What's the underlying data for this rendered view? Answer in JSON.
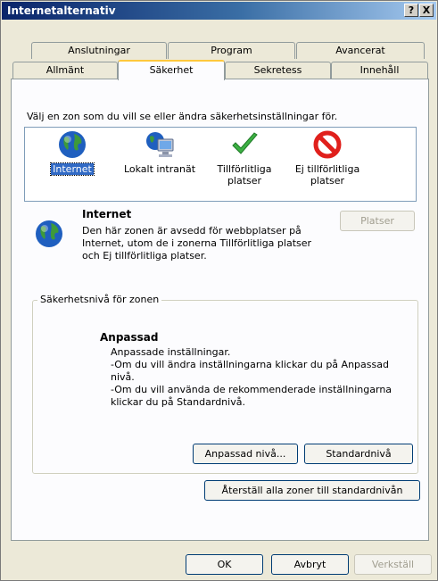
{
  "window": {
    "title": "Internetalternativ",
    "help_button": "?",
    "close_button": "X"
  },
  "tabs": {
    "row1": [
      "Anslutningar",
      "Program",
      "Avancerat"
    ],
    "row2": [
      "Allmänt",
      "Säkerhet",
      "Sekretess",
      "Innehåll"
    ],
    "active": "Säkerhet"
  },
  "zones": {
    "prompt": "Välj en zon som du vill se eller ändra säkerhetsinställningar för.",
    "items": [
      {
        "label": "Internet",
        "icon": "globe-icon",
        "selected": true
      },
      {
        "label": "Lokalt intranät",
        "icon": "intranet-computer-icon",
        "selected": false
      },
      {
        "label": "Tillförlitliga platser",
        "icon": "green-checkmark-icon",
        "selected": false
      },
      {
        "label": "Ej tillförlitliga platser",
        "icon": "red-prohibited-icon",
        "selected": false
      }
    ]
  },
  "zone_info": {
    "title": "Internet",
    "description_lines": [
      "Den här zonen är avsedd för webbplatser på",
      "Internet, utom de i zonerna Tillförlitliga platser",
      "och Ej tillförlitliga platser."
    ],
    "sites_button": "Platser",
    "sites_enabled": false
  },
  "security_level": {
    "legend": "Säkerhetsnivå för zonen",
    "level_title": "Anpassad",
    "lines": [
      "Anpassade inställningar.",
      "-Om du vill ändra inställningarna klickar du på Anpassad",
      "nivå.",
      "-Om du vill använda de rekommenderade inställningarna",
      "klickar du på Standardnivå."
    ],
    "custom_button": "Anpassad nivå...",
    "default_button": "Standardnivå"
  },
  "reset_button": "Återställ alla zoner till standardnivån",
  "footer": {
    "ok": "OK",
    "cancel": "Avbryt",
    "apply": "Verkställ",
    "apply_enabled": false
  },
  "colors": {
    "titlebar_start": "#0a246a",
    "titlebar_end": "#a6caf0",
    "selection": "#316ac5",
    "active_tab_accent": "#ffc83c"
  }
}
